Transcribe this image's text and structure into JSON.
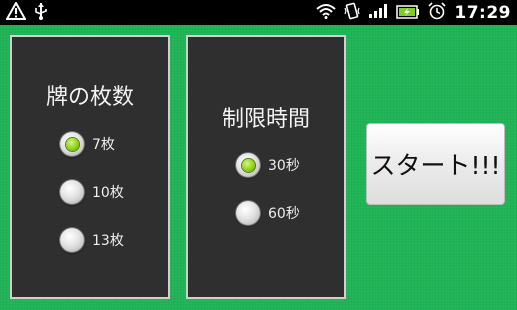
{
  "status_bar": {
    "time": "17:29",
    "icons": [
      "warning-icon",
      "usb-icon",
      "wifi-icon",
      "vibrate-icon",
      "signal-icon",
      "battery-charging-icon",
      "alarm-icon"
    ]
  },
  "tile_count_panel": {
    "title": "牌の枚数",
    "options": [
      {
        "label": "7枚",
        "selected": true
      },
      {
        "label": "10枚",
        "selected": false
      },
      {
        "label": "13枚",
        "selected": false
      }
    ]
  },
  "time_limit_panel": {
    "title": "制限時間",
    "options": [
      {
        "label": "30秒",
        "selected": true
      },
      {
        "label": "60秒",
        "selected": false
      }
    ]
  },
  "start_button": {
    "label": "スタート!!!"
  },
  "colors": {
    "background": "#20b457",
    "panel": "#2f2f2f",
    "panel_border": "#cfcfcf",
    "radio_selected": "#8fd21b"
  }
}
